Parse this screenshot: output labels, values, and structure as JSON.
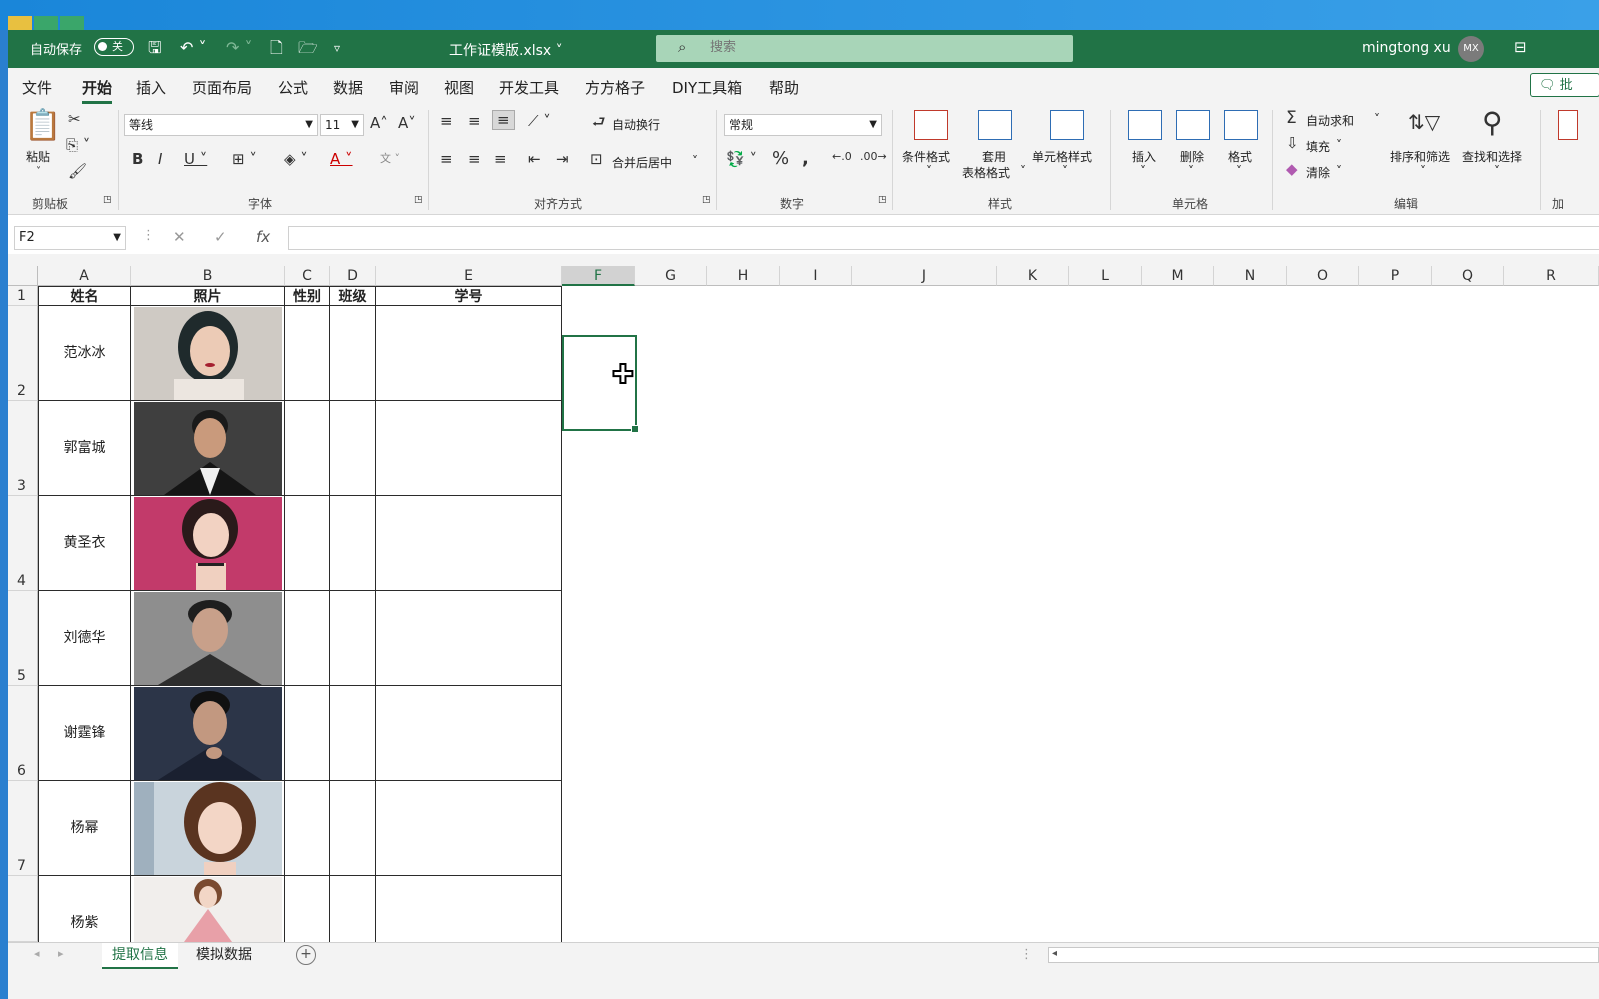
{
  "titlebar": {
    "autosave_label": "自动保存",
    "autosave_state": "关",
    "filename": "工作证模版.xlsx",
    "search_placeholder": "搜索",
    "user_name": "mingtong xu",
    "user_initials": "MX"
  },
  "menu": {
    "tabs": [
      "文件",
      "开始",
      "插入",
      "页面布局",
      "公式",
      "数据",
      "审阅",
      "视图",
      "开发工具",
      "方方格子",
      "DIY工具箱",
      "帮助"
    ],
    "active_tab": "开始",
    "share_label": "批"
  },
  "ribbon": {
    "paste_label": "粘贴",
    "font_name": "等线",
    "font_size": "11",
    "wrap_text_label": "自动换行",
    "merge_center_label": "合并后居中",
    "number_format": "常规",
    "conditional_format_label": "条件格式",
    "table_format_label_1": "套用",
    "table_format_label_2": "表格格式",
    "cell_styles_label": "单元格样式",
    "insert_label": "插入",
    "delete_label": "删除",
    "format_label": "格式",
    "autosum_label": "自动求和",
    "fill_label": "填充",
    "clear_label": "清除",
    "sort_filter_label": "排序和筛选",
    "find_select_label": "查找和选择",
    "groups": {
      "clipboard": "剪贴板",
      "font": "字体",
      "alignment": "对齐方式",
      "number": "数字",
      "styles": "样式",
      "cells": "单元格",
      "editing": "编辑",
      "addins": "加"
    }
  },
  "formula_bar": {
    "name_box": "F2",
    "formula": ""
  },
  "grid": {
    "columns": [
      "A",
      "B",
      "C",
      "D",
      "E",
      "F",
      "G",
      "H",
      "I",
      "J",
      "K",
      "L",
      "M",
      "N",
      "O",
      "P",
      "Q",
      "R"
    ],
    "selected_column": "F",
    "row_numbers": [
      "1",
      "2",
      "3",
      "4",
      "5",
      "6",
      "7"
    ],
    "header_row": {
      "name": "姓名",
      "photo": "照片",
      "gender": "性别",
      "class": "班级",
      "student_id": "学号"
    },
    "rows": [
      {
        "name": "范冰冰"
      },
      {
        "name": "郭富城"
      },
      {
        "name": "黄圣衣"
      },
      {
        "name": "刘德华"
      },
      {
        "name": "谢霆锋"
      },
      {
        "name": "杨幂"
      },
      {
        "name": "杨紫"
      }
    ]
  },
  "sheets": {
    "tabs": [
      "提取信息",
      "模拟数据"
    ],
    "active": "提取信息"
  },
  "colors": {
    "excel_green": "#217346",
    "ribbon_bg": "#f3f3f3"
  }
}
